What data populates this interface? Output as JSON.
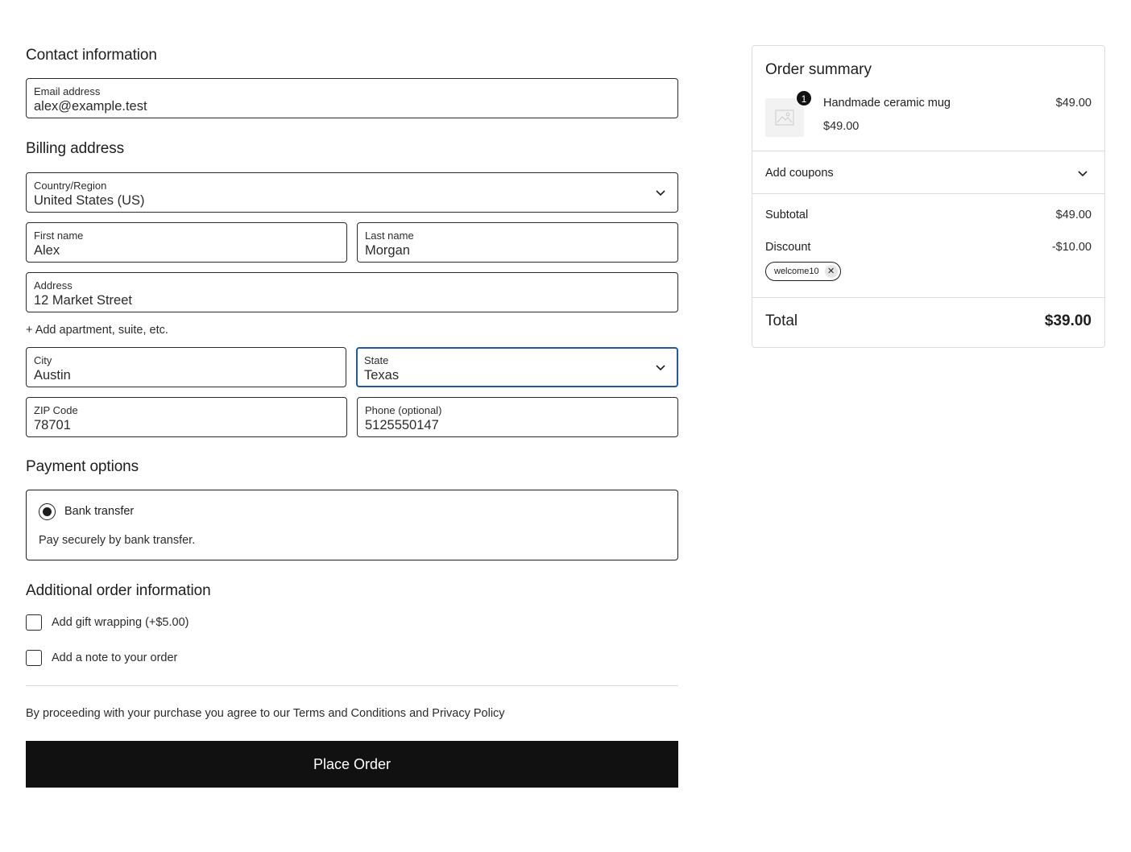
{
  "contact": {
    "heading": "Contact information",
    "email_label": "Email address",
    "email_value": "alex@example.test"
  },
  "billing": {
    "heading": "Billing address",
    "country_label": "Country/Region",
    "country_value": "United States (US)",
    "first_name_label": "First name",
    "first_name_value": "Alex",
    "last_name_label": "Last name",
    "last_name_value": "Morgan",
    "address_label": "Address",
    "address_value": "12 Market Street",
    "add_apartment": "+ Add apartment, suite, etc.",
    "city_label": "City",
    "city_value": "Austin",
    "state_label": "State",
    "state_value": "Texas",
    "zip_label": "ZIP Code",
    "zip_value": "78701",
    "phone_label": "Phone (optional)",
    "phone_value": "5125550147"
  },
  "payment": {
    "heading": "Payment options",
    "method_label": "Bank transfer",
    "method_description": "Pay securely by bank transfer."
  },
  "additional": {
    "heading": "Additional order information",
    "gift_wrap_label": "Add gift wrapping (+$5.00)",
    "note_label": "Add a note to your order"
  },
  "terms_text": "By proceeding with your purchase you agree to our Terms and Conditions and Privacy Policy",
  "place_order_label": "Place Order",
  "summary": {
    "title": "Order summary",
    "item": {
      "quantity": "1",
      "name": "Handmade ceramic mug",
      "unit_price": "$49.00",
      "line_price": "$49.00"
    },
    "coupons_label": "Add coupons",
    "subtotal_label": "Subtotal",
    "subtotal_value": "$49.00",
    "discount_label": "Discount",
    "discount_value": "-$10.00",
    "coupon_code": "welcome10",
    "total_label": "Total",
    "total_value": "$39.00"
  },
  "colors": {
    "focus_border": "#1e5aa8",
    "button_bg": "#111111"
  }
}
